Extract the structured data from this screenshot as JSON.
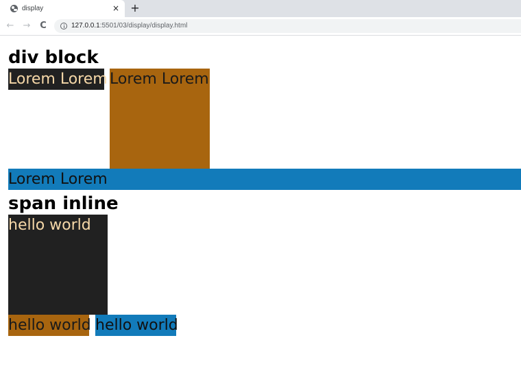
{
  "browser": {
    "tab_title": "display",
    "tab_close": "×",
    "new_tab": "+",
    "back": "←",
    "forward": "→",
    "reload": "C",
    "url_host": "127.0.0.1",
    "url_path": ":5501/03/display/display.html"
  },
  "content": {
    "heading_div": "div block",
    "div_box1": "Lorem Lorem",
    "div_box2": "Lorem Lorem",
    "div_box3": "Lorem Lorem",
    "heading_span": "span inline",
    "span_box1": "hello world",
    "span_box2": "hello world",
    "span_box3": "hello world"
  },
  "colors": {
    "dark": "#212121",
    "brown": "#a8650f",
    "blue": "#127bba",
    "light_text": "#f6d8a8"
  }
}
